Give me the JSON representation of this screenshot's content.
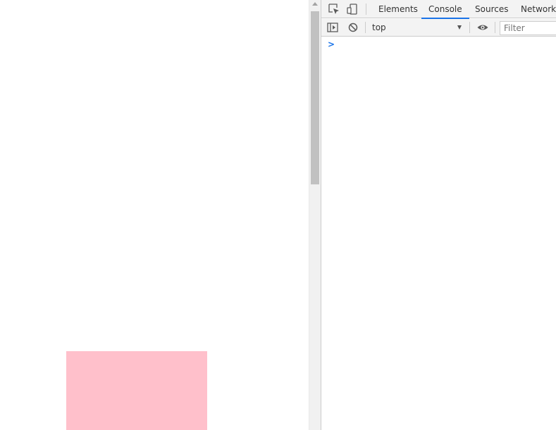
{
  "page": {
    "box_color": "#ffc0cb"
  },
  "devtools": {
    "tabs": [
      {
        "label": "Elements"
      },
      {
        "label": "Console"
      },
      {
        "label": "Sources"
      },
      {
        "label": "Network"
      }
    ],
    "active_tab": "Console",
    "toolbar": {
      "context": "top",
      "filter_placeholder": "Filter"
    },
    "console": {
      "prompt_symbol": ">"
    },
    "icons": [
      "inspect-element-icon",
      "device-toolbar-icon",
      "sidebar-toggle-icon",
      "clear-console-icon",
      "live-expression-eye-icon"
    ],
    "accent_color": "#1a73e8"
  }
}
